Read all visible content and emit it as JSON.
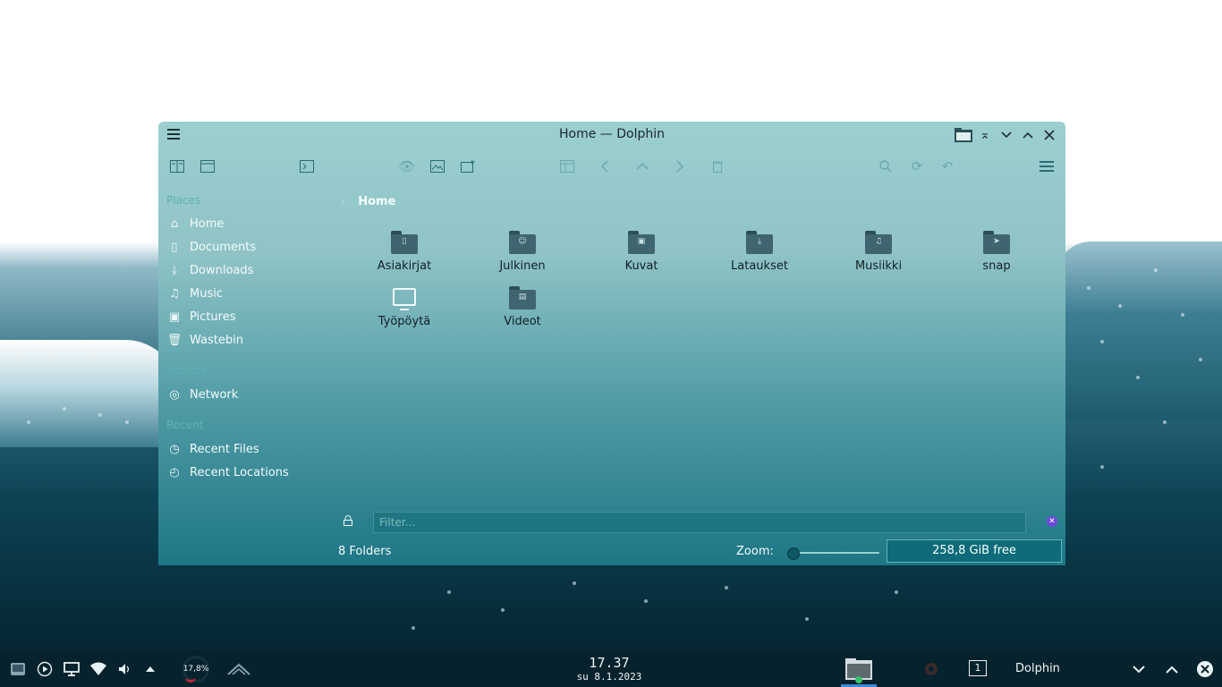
{
  "window": {
    "title": "Home — Dolphin",
    "breadcrumb": "Home"
  },
  "toolbar_icons": [
    "split-view-icon",
    "new-window-icon",
    "terminal-icon",
    "preview-icon",
    "image-icon",
    "new-tab-icon",
    "panel-icon",
    "back-icon",
    "up-icon",
    "forward-icon",
    "trash-icon",
    "search-icon",
    "reload-icon",
    "undo-icon",
    "menu-icon"
  ],
  "sidebar": {
    "places_header": "Places",
    "places": [
      {
        "label": "Home",
        "icon": "home-icon"
      },
      {
        "label": "Documents",
        "icon": "document-icon"
      },
      {
        "label": "Downloads",
        "icon": "download-icon"
      },
      {
        "label": "Music",
        "icon": "music-icon"
      },
      {
        "label": "Pictures",
        "icon": "picture-icon"
      },
      {
        "label": "Wastebin",
        "icon": "trash-icon"
      }
    ],
    "remote_header": "Remote",
    "remote": [
      {
        "label": "Network",
        "icon": "network-icon"
      }
    ],
    "recent_header": "Recent",
    "recent": [
      {
        "label": "Recent Files",
        "icon": "recent-files-icon"
      },
      {
        "label": "Recent Locations",
        "icon": "recent-locations-icon"
      }
    ]
  },
  "folders": [
    {
      "name": "Asiakirjat",
      "glyph": "document"
    },
    {
      "name": "Julkinen",
      "glyph": "people"
    },
    {
      "name": "Kuvat",
      "glyph": "image"
    },
    {
      "name": "Lataukset",
      "glyph": "download"
    },
    {
      "name": "Musiikki",
      "glyph": "music"
    },
    {
      "name": "snap",
      "glyph": "snap"
    },
    {
      "name": "Työpöytä",
      "glyph": "desktop"
    },
    {
      "name": "Videot",
      "glyph": "video"
    }
  ],
  "filter": {
    "placeholder": "Filter..."
  },
  "status": {
    "folder_count": "8 Folders",
    "zoom_label": "Zoom:",
    "free_space": "258,8 GiB free"
  },
  "taskbar": {
    "cpu_load": "17,8%",
    "time": "17.37",
    "date": "su 8.1.2023",
    "virtual_desktop": "1",
    "active_task": "Dolphin"
  }
}
